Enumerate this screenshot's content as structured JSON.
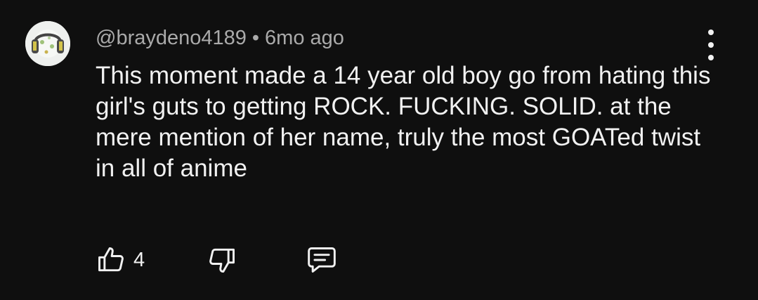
{
  "comment": {
    "author": "@braydeno4189",
    "separator": "•",
    "time": "6mo ago",
    "text": "This moment made a 14 year old boy go from hating this girl's guts to getting ROCK. FUCKING. SOLID. at the mere mention of her name, truly the most GOATed twist in all of anime",
    "like_count": "4"
  },
  "icons": {
    "avatar": "avatar-image",
    "menu": "more-vertical-icon",
    "like": "thumbs-up-icon",
    "dislike": "thumbs-down-icon",
    "reply": "comment-reply-icon"
  },
  "colors": {
    "background": "#0f0f0f",
    "primary_text": "#f1f1f1",
    "secondary_text": "#aaaaaa"
  }
}
